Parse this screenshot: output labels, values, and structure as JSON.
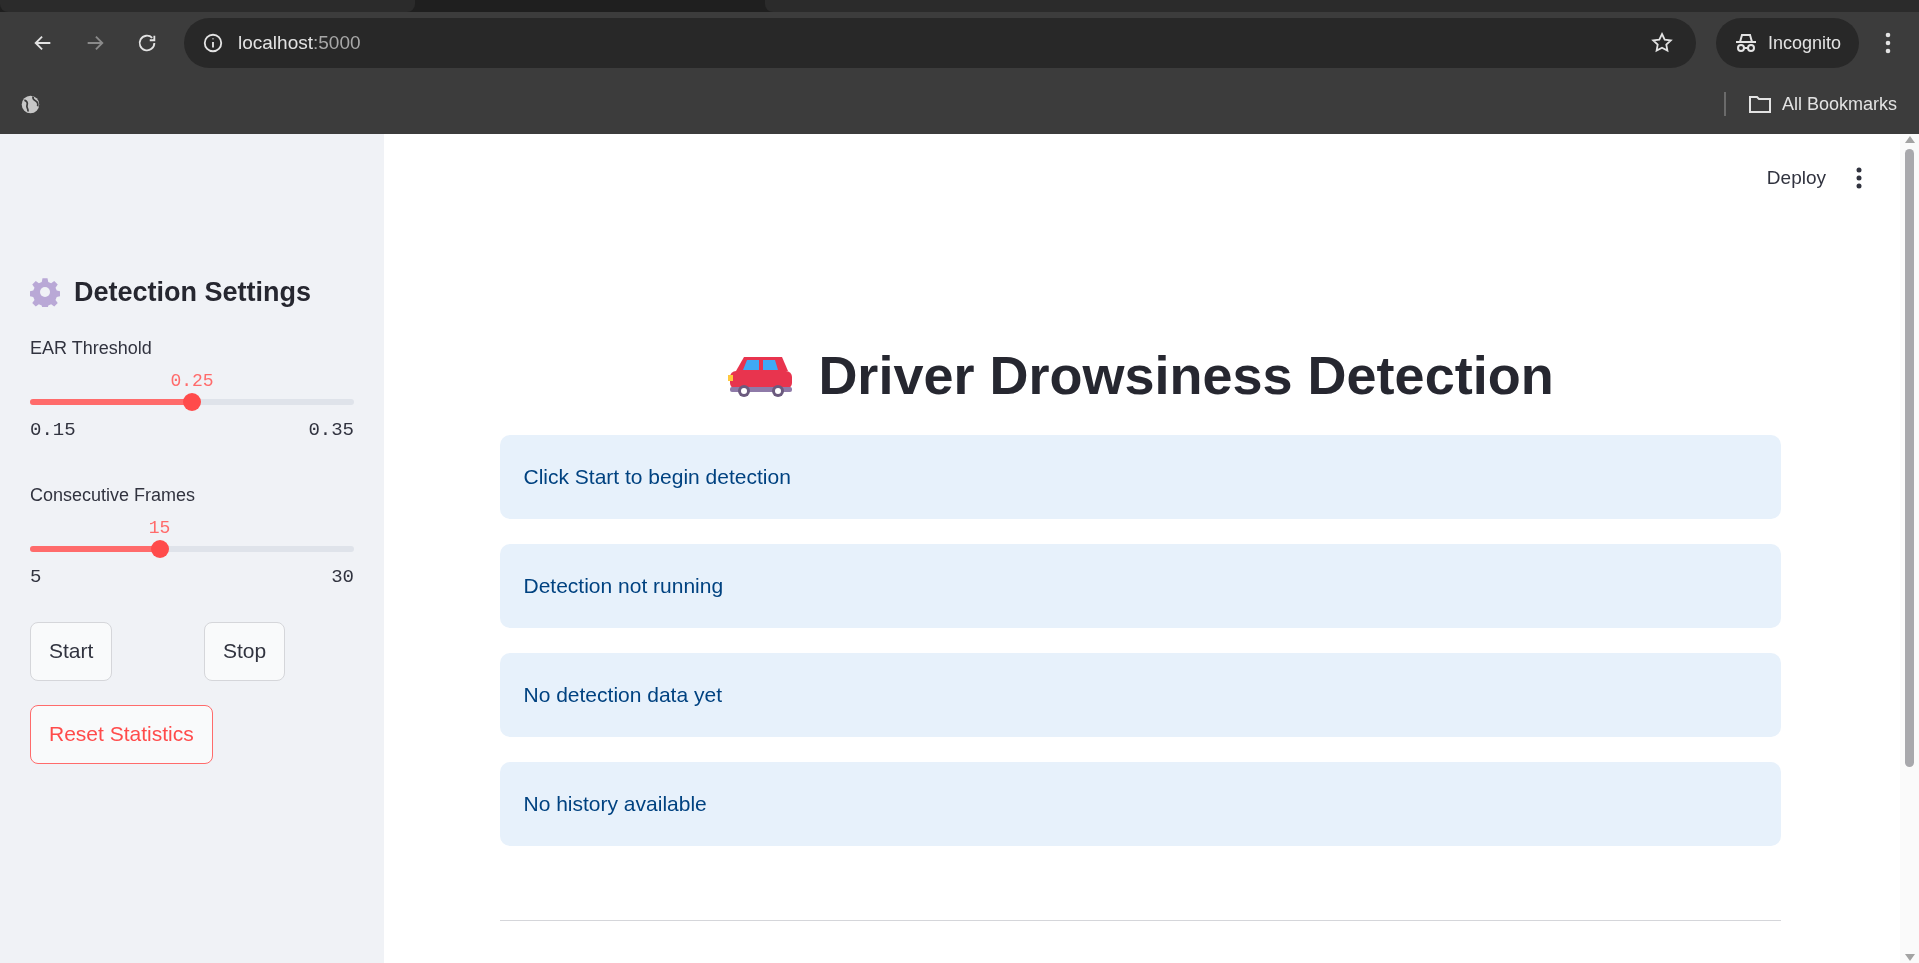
{
  "browser": {
    "url_host": "localhost",
    "url_port": ":5000",
    "profile_label": "Incognito",
    "bookmarks_label": "All Bookmarks"
  },
  "sidebar": {
    "title": "Detection Settings",
    "sliders": [
      {
        "label": "EAR Threshold",
        "value": "0.25",
        "min": "0.15",
        "max": "0.35",
        "level": 0.5
      },
      {
        "label": "Consecutive Frames",
        "value": "15",
        "min": "5",
        "max": "30",
        "level": 0.4
      }
    ],
    "buttons": [
      {
        "label": "Start",
        "kind": "plain"
      },
      {
        "label": "Stop",
        "kind": "plain"
      },
      {
        "label": "Reset Statistics",
        "kind": "danger"
      }
    ]
  },
  "header": {
    "deploy": "Deploy"
  },
  "main": {
    "title": "Driver Drowsiness Detection",
    "alerts": [
      "Click Start to begin detection",
      "Detection not running",
      "No detection data yet",
      "No history available"
    ]
  }
}
